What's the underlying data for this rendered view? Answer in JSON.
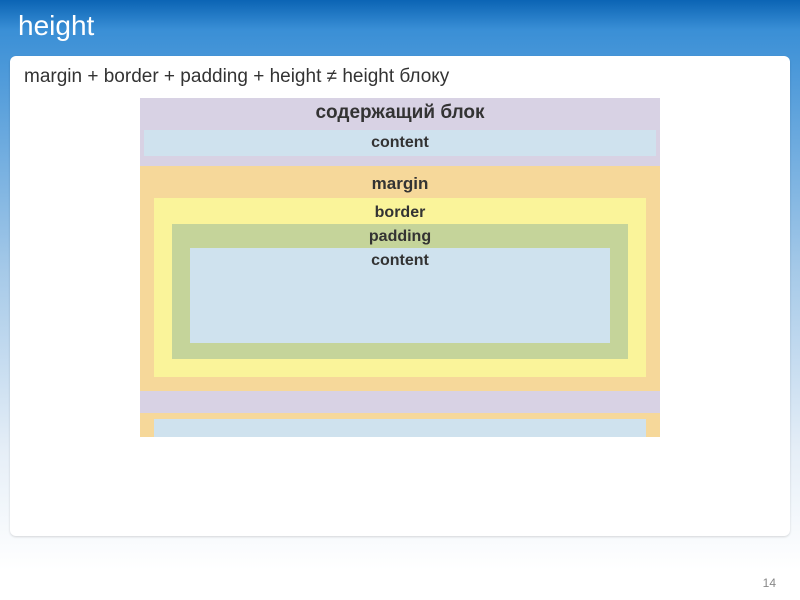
{
  "slide": {
    "title": "height",
    "formula": "margin + border + padding + height ≠ height блоку",
    "page_number": "14"
  },
  "diagram": {
    "containing_label": "содержащий блок",
    "top_content_label": "content",
    "margin_label": "margin",
    "border_label": "border",
    "padding_label": "padding",
    "content_label": "content"
  }
}
